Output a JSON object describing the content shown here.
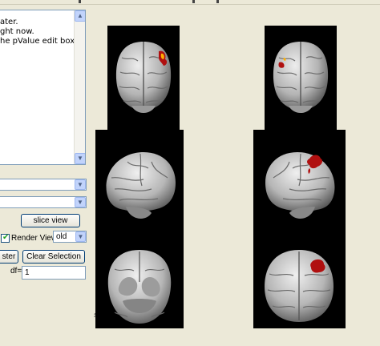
{
  "log": {
    "lines": [
      "ater.",
      "ght now.",
      "he pValue edit box."
    ]
  },
  "controls": {
    "slice_view_label": "slice view",
    "render_view_label": "Render View",
    "render_view_checked": true,
    "render_mode_value": "old",
    "cluster_button_label": "ster",
    "clear_selection_label": "Clear Selection",
    "df_label": "df=",
    "df_value": "1"
  },
  "viewer": {
    "watermark": "ster"
  },
  "colors": {
    "activation": "#b01010",
    "activation_hot": "#ffb000",
    "panel_bg": "#000000",
    "button_border": "#003c74"
  },
  "icons": {
    "scroll_up": "chevron-up-icon",
    "scroll_down": "chevron-down-icon",
    "dropdown": "chevron-down-icon",
    "checkbox": "check-icon"
  }
}
